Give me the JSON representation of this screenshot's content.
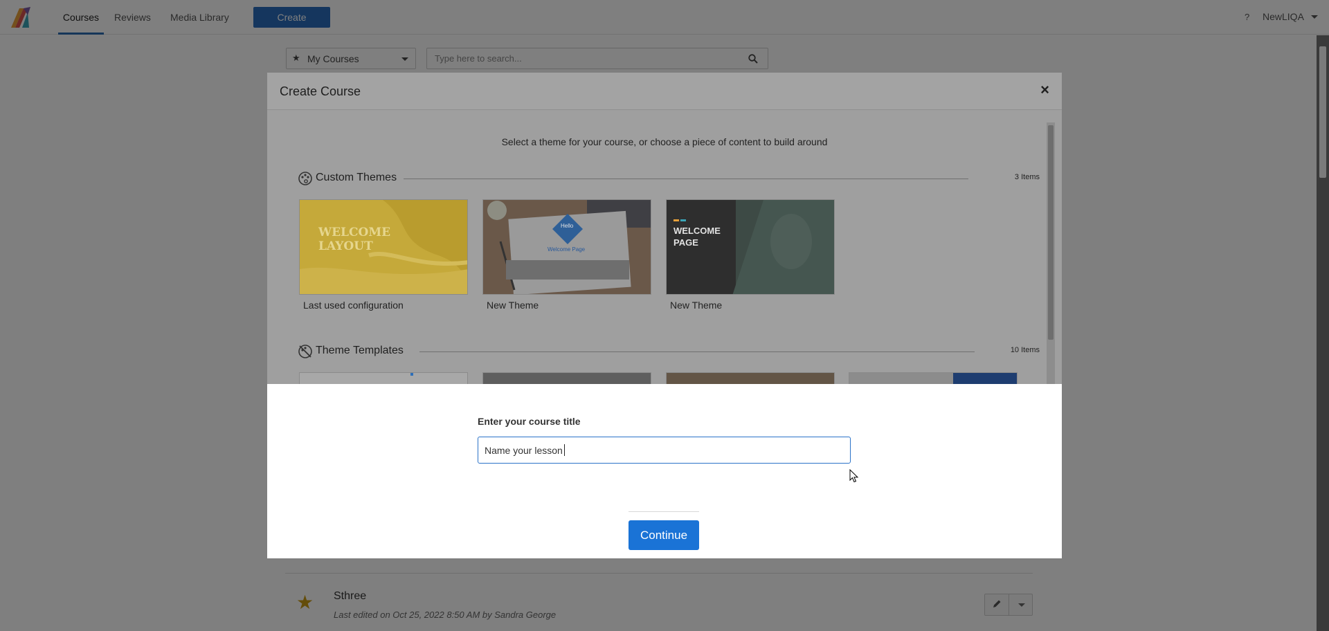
{
  "nav": {
    "items": [
      "Courses",
      "Reviews",
      "Media Library"
    ],
    "active": "Courses",
    "create_label": "Create",
    "help_label": "?",
    "user_label": "NewLIQA"
  },
  "toolbar": {
    "filter_label": "My Courses",
    "search_placeholder": "Type here to search..."
  },
  "background_list": {
    "row": {
      "title": "Sthree",
      "meta": "Last edited on Oct 25, 2022 8:50 AM by Sandra George"
    }
  },
  "modal": {
    "title": "Create Course",
    "close_label": "×",
    "subtitle": "Select a theme for your course, or choose a piece of content to build around",
    "custom_themes": {
      "title": "Custom Themes",
      "count": "3 Items",
      "items": [
        {
          "caption": "Last used configuration",
          "thumb_text": "WELCOME LAYOUT"
        },
        {
          "caption": "New Theme",
          "thumb_text": "Hello",
          "thumb_sub": "Welcome Page"
        },
        {
          "caption": "New Theme",
          "thumb_text": "WELCOME PAGE"
        }
      ]
    },
    "theme_templates": {
      "title": "Theme Templates",
      "count": "10 Items"
    }
  },
  "naming": {
    "label": "Enter your course title",
    "input_value": "Name your lesson",
    "continue_label": "Continue"
  },
  "colors": {
    "accent": "#1a73d6",
    "nav_active": "#2a6cb3",
    "star": "#c99a14"
  }
}
